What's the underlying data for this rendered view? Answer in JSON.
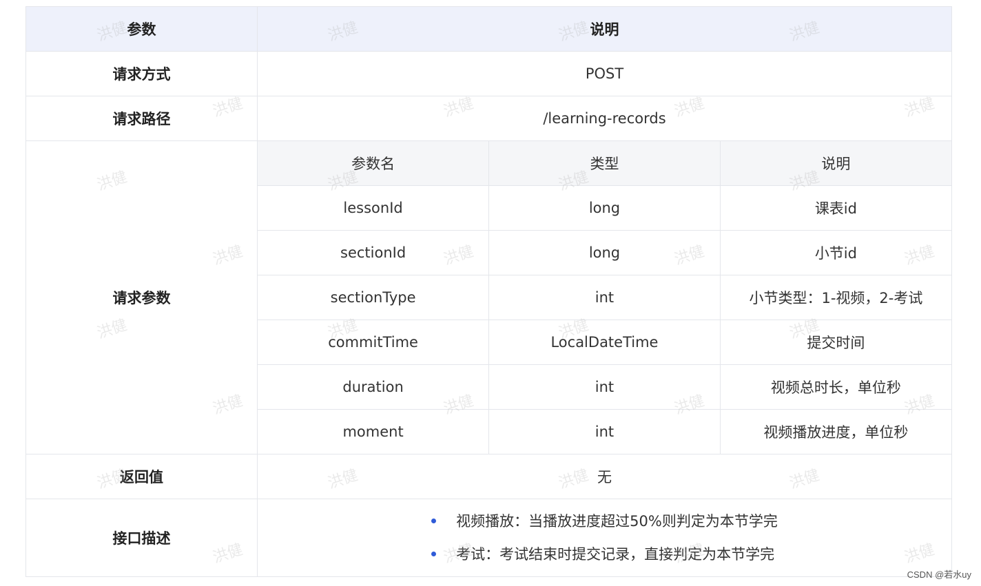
{
  "table": {
    "header": {
      "param": "参数",
      "desc": "说明"
    },
    "method": {
      "label": "请求方式",
      "value": "POST"
    },
    "path": {
      "label": "请求路径",
      "value": "/learning-records"
    },
    "params": {
      "label": "请求参数",
      "columns": [
        "参数名",
        "类型",
        "说明"
      ],
      "rows": [
        {
          "name": "lessonId",
          "type": "long",
          "desc": "课表id"
        },
        {
          "name": "sectionId",
          "type": "long",
          "desc": "小节id"
        },
        {
          "name": "sectionType",
          "type": "int",
          "desc": "小节类型：1-视频，2-考试"
        },
        {
          "name": "commitTime",
          "type": "LocalDateTime",
          "desc": "提交时间"
        },
        {
          "name": "duration",
          "type": "int",
          "desc": "视频总时长，单位秒"
        },
        {
          "name": "moment",
          "type": "int",
          "desc": "视频播放进度，单位秒"
        }
      ]
    },
    "return": {
      "label": "返回值",
      "value": "无"
    },
    "description": {
      "label": "接口描述",
      "items": [
        "视频播放：当播放进度超过50%则判定为本节学完",
        "考试：考试结束时提交记录，直接判定为本节学完"
      ]
    }
  },
  "watermark_text": "洪健",
  "footer_mark": "CSDN @若水uy",
  "colors": {
    "header_bg": "#eef1fb",
    "nested_header_bg": "#f5f6f8",
    "border": "#e4e6eb",
    "bullet": "#2f5bd8"
  }
}
